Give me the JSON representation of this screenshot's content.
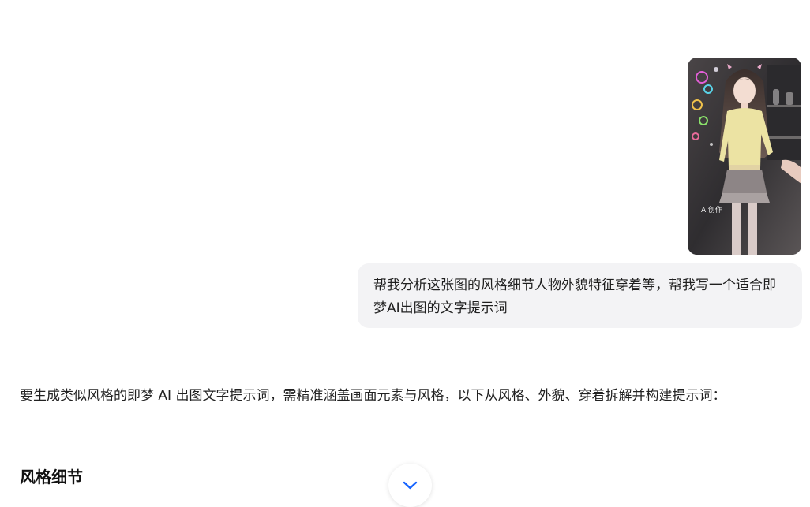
{
  "user_message": {
    "image_watermark": "AI创作",
    "text": "帮我分析这张图的风格细节人物外貌特征穿着等，帮我写一个适合即梦AI出图的文字提示词"
  },
  "assistant_reply": {
    "intro": "要生成类似风格的即梦 AI 出图文字提示词，需精准涵盖画面元素与风格，以下从风格、外貌、穿着拆解并构建提示词：",
    "heading": "风格细节"
  },
  "scroll_button": {
    "icon": "chevron-down-icon"
  },
  "colors": {
    "bubble_background": "#f3f3f5",
    "accent": "#1664ff"
  }
}
